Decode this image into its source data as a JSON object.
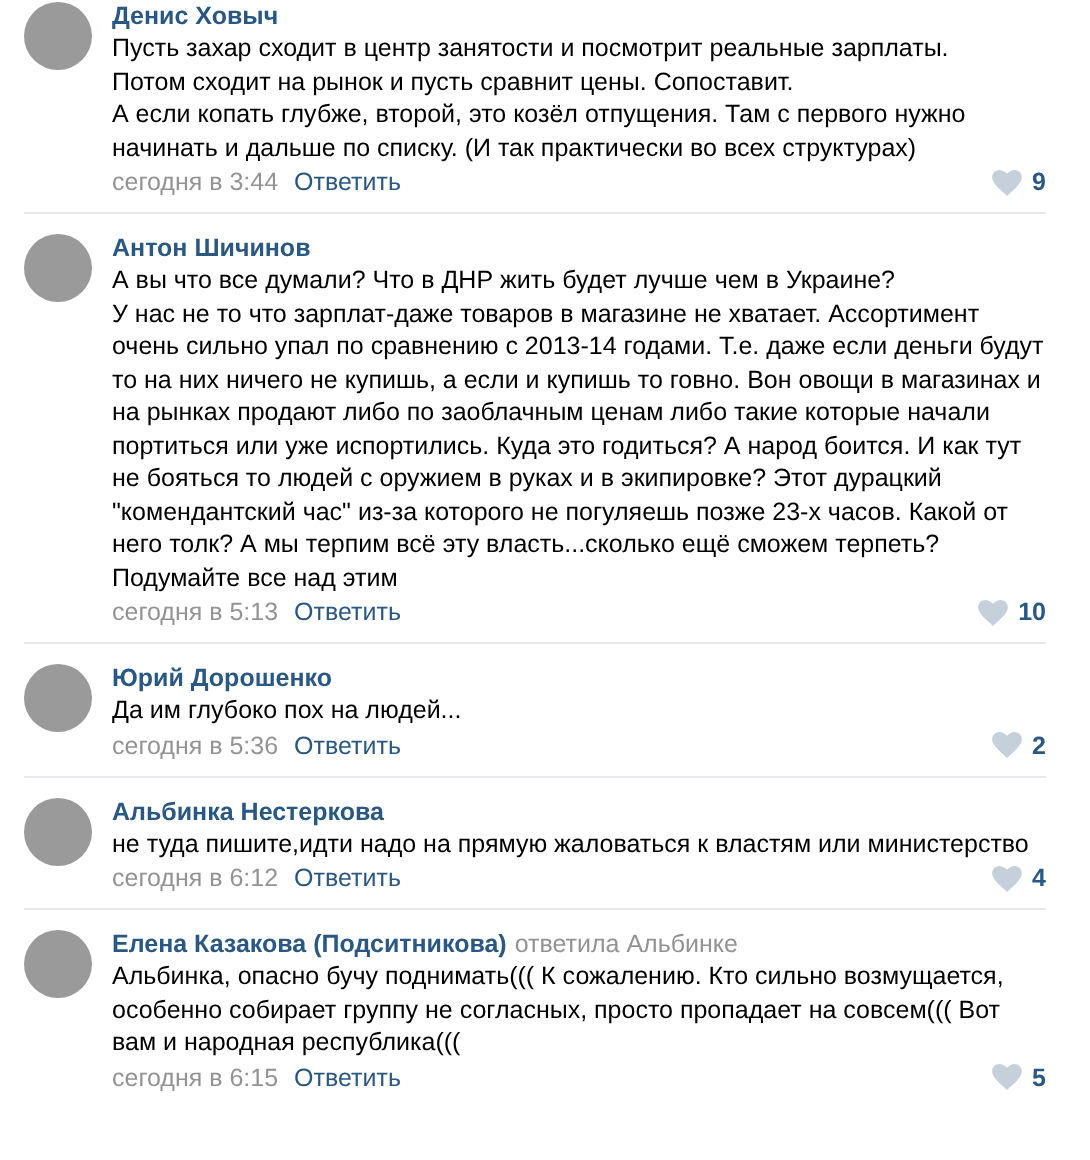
{
  "comments": [
    {
      "author": "Денис Ховыч",
      "paragraphs": [
        "Пусть захар сходит в центр занятости и посмотрит реальные зарплаты.",
        "Потом сходит на рынок и пусть сравнит цены. Сопоставит.",
        "А если копать глубже, второй, это козёл отпущения. Там с первого нужно начинать и дальше по списку. (И так практически во всех структурах)"
      ],
      "time": "сегодня в 3:44",
      "reply_label": "Ответить",
      "likes": "9"
    },
    {
      "author": "Антон Шичинов",
      "paragraphs": [
        "А вы что все думали? Что в ДНР жить будет лучше чем в Украине?",
        "У нас не то что зарплат-даже товаров в магазине не хватает. Ассортимент очень сильно упал по сравнению с 2013-14 годами. Т.е. даже если деньги будут то на них ничего не купишь, а если и купишь то говно. Вон овощи в магазинах и на рынках продают либо по заоблачным ценам либо такие которые начали портиться или уже испортились. Куда это годиться? А народ боится. И как тут не бояться то людей с оружием в руках и в экипировке? Этот дурацкий \"комендантский час\" из-за которого не погуляешь позже 23-х часов. Какой от него толк? А мы терпим всё эту власть...сколько ещё сможем терпеть? Подумайте все над этим"
      ],
      "time": "сегодня в 5:13",
      "reply_label": "Ответить",
      "likes": "10"
    },
    {
      "author": "Юрий Дорошенко",
      "paragraphs": [
        "Да им глубоко пох на людей..."
      ],
      "time": "сегодня в 5:36",
      "reply_label": "Ответить",
      "likes": "2"
    },
    {
      "author": "Альбинка Нестеркова",
      "paragraphs": [
        "не туда пишите,идти надо на прямую жаловаться к властям или министерство"
      ],
      "time": "сегодня в 6:12",
      "reply_label": "Ответить",
      "likes": "4"
    },
    {
      "author": "Елена Казакова (Подситникова)",
      "reply_to": "ответила Альбинке",
      "paragraphs": [
        "Альбинка, опасно бучу поднимать((( К сожалению. Кто сильно возмущается, особенно собирает группу не согласных, просто пропадает на совсем((( Вот вам и народная республика((("
      ],
      "time": "сегодня в 6:15",
      "reply_label": "Ответить",
      "likes": "5"
    }
  ]
}
